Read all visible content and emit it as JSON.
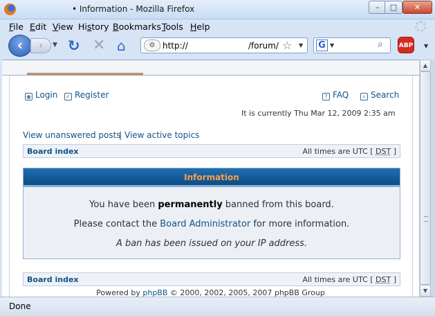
{
  "window": {
    "title": "• Information - Mozilla Firefox",
    "min_label": "–",
    "max_label": "□",
    "close_label": "✕"
  },
  "menubar": [
    {
      "label": "File",
      "mnemonic": "F",
      "rest": "ile"
    },
    {
      "label": "Edit",
      "mnemonic": "E",
      "rest": "dit"
    },
    {
      "label": "View",
      "mnemonic": "V",
      "rest": "iew"
    },
    {
      "label": "History",
      "mnemonic": "s",
      "pre": "Hi",
      "rest": "tory"
    },
    {
      "label": "Bookmarks",
      "mnemonic": "B",
      "rest": "ookmarks"
    },
    {
      "label": "Tools",
      "mnemonic": "T",
      "rest": "ools"
    },
    {
      "label": "Help",
      "mnemonic": "H",
      "rest": "elp"
    }
  ],
  "toolbar": {
    "back_icon": "back-arrow-icon",
    "forward_icon": "forward-arrow-icon",
    "reload_icon": "reload-icon",
    "stop_icon": "stop-icon",
    "home_icon": "home-icon",
    "url_prefix": "http://",
    "url_path": "/forum/",
    "search_value": "",
    "search_engine": "G",
    "adblock_label": "ABP"
  },
  "page": {
    "login": "Login",
    "register": "Register",
    "faq": "FAQ",
    "search": "Search",
    "clock": "It is currently Thu Mar 12, 2009 2:35 am",
    "view_unanswered": "View unanswered posts",
    "separator": "|",
    "view_active": "View active topics",
    "board_index": "Board index",
    "timezone_prefix": "All times are UTC [",
    "dst": "DST",
    "timezone_suffix": "]",
    "info_title": "Information",
    "ban_pre": "You have been",
    "ban_bold": "permanently",
    "ban_post": "banned from this board.",
    "contact_pre": "Please contact the",
    "contact_link": "Board Administrator",
    "contact_post": "for more information.",
    "ban_reason": "A ban has been issued on your IP address.",
    "footer_pre": "Powered by",
    "footer_link": "phpBB",
    "footer_post": "© 2000, 2002, 2005, 2007 phpBB Group"
  },
  "status": {
    "text": "Done"
  },
  "colors": {
    "link": "#105289",
    "info_header": "#0b4d86",
    "info_title": "#ff9e48"
  }
}
